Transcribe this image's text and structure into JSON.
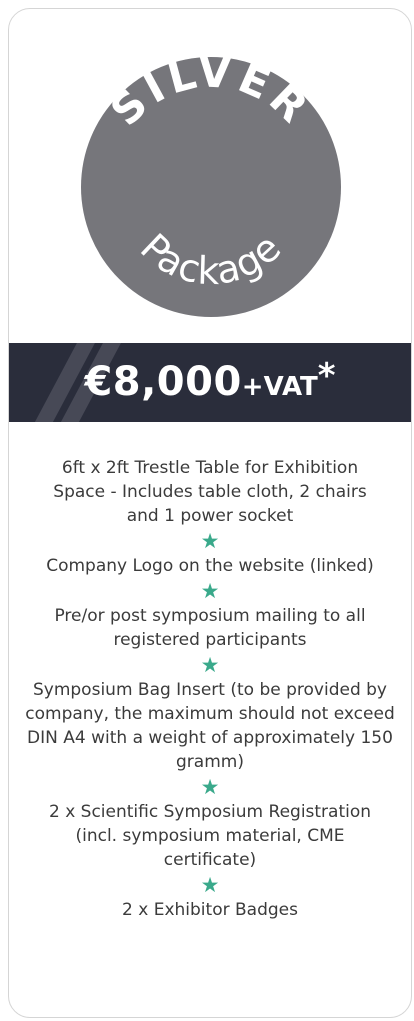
{
  "package": {
    "tier": "SILVER",
    "subtitle": "Package",
    "price": "€8,000",
    "vat": "+VAT",
    "asterisk": "*"
  },
  "features": [
    "6ft x 2ft Trestle Table for Exhibition Space - Includes table cloth, 2 chairs and 1 power socket",
    "Company Logo on the website (linked)",
    "Pre/or post symposium mailing to all registered participants",
    "Symposium Bag Insert (to be provided by company, the maximum should not exceed DIN A4 with a weight of approximately 150 gramm)",
    "2 x Scientific Symposium Registration (incl. symposium material, CME certificate)",
    "2 x Exhibitor Badges"
  ],
  "icons": {
    "separator": "star-icon",
    "star_glyph": "★"
  },
  "colors": {
    "badge": "#76767b",
    "price_band": "#2a2d3b",
    "star": "#3aa98b",
    "text": "#3b3b3b"
  }
}
